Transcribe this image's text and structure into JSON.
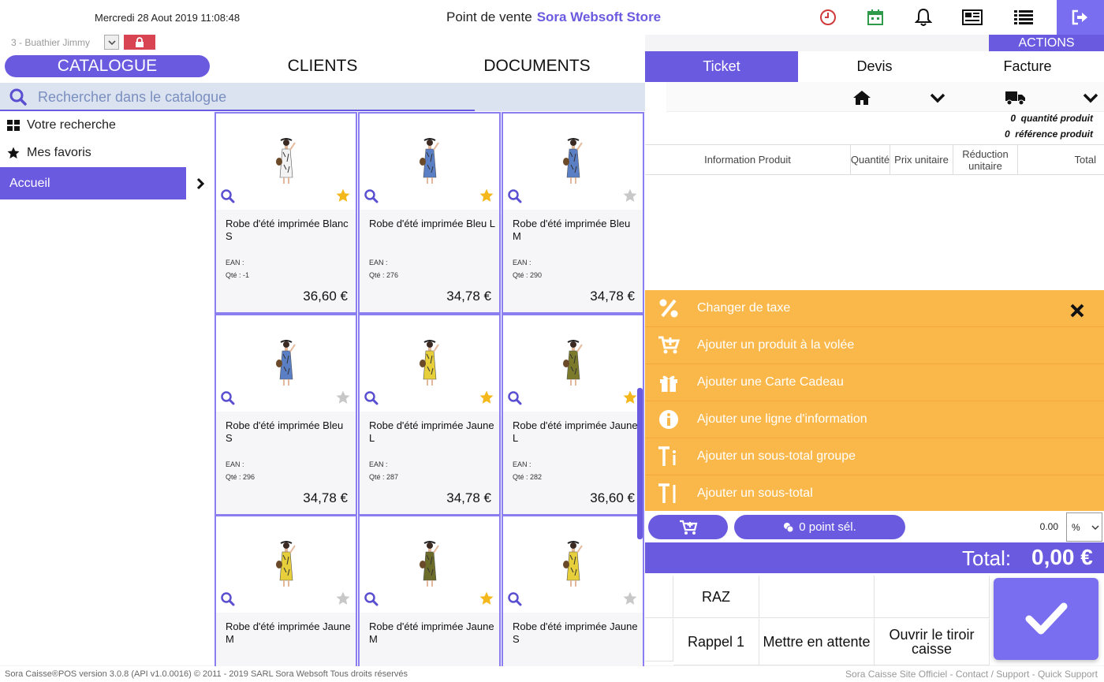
{
  "header": {
    "datetime": "Mercredi 28 Aout 2019 11:08:48",
    "title_prefix": "Point de vente",
    "store_name": "Sora Websoft Store",
    "user_name": "3 - Buathier Jimmy",
    "actions_label": "ACTIONS"
  },
  "tabs": {
    "catalogue": "CATALOGUE",
    "clients": "CLIENTS",
    "documents": "DOCUMENTS"
  },
  "search": {
    "placeholder": "Rechercher dans le catalogue"
  },
  "left_menu": {
    "search": "Votre recherche",
    "favorites": "Mes favoris",
    "home": "Accueil"
  },
  "products": [
    {
      "name": "Robe d'été imprimée Blanc S",
      "ean": "EAN :",
      "qte": "Qté : -1",
      "price": "36,60 €",
      "fav": true,
      "color": "#f3f3f3"
    },
    {
      "name": "Robe d'été imprimée Bleu L",
      "ean": "EAN :",
      "qte": "Qté : 276",
      "price": "34,78 €",
      "fav": true,
      "color": "#5b7fc4"
    },
    {
      "name": "Robe d'été imprimée Bleu M",
      "ean": "EAN :",
      "qte": "Qté : 290",
      "price": "34,78 €",
      "fav": false,
      "color": "#5b7fc4"
    },
    {
      "name": "Robe d'été imprimée Bleu S",
      "ean": "EAN :",
      "qte": "Qté : 296",
      "price": "34,78 €",
      "fav": false,
      "color": "#5b7fc4"
    },
    {
      "name": "Robe d'été imprimée Jaune L",
      "ean": "EAN :",
      "qte": "Qté : 287",
      "price": "34,78 €",
      "fav": true,
      "color": "#e6cf3a"
    },
    {
      "name": "Robe d'été imprimée Jaune L",
      "ean": "EAN :",
      "qte": "Qté : 282",
      "price": "36,60 €",
      "fav": true,
      "color": "#7a7a2a"
    },
    {
      "name": "Robe d'été imprimée Jaune M",
      "ean": "",
      "qte": "",
      "price": "",
      "fav": false,
      "color": "#e6cf3a"
    },
    {
      "name": "Robe d'été imprimée Jaune M",
      "ean": "",
      "qte": "",
      "price": "",
      "fav": true,
      "color": "#6b6b2a"
    },
    {
      "name": "Robe d'été imprimée Jaune S",
      "ean": "",
      "qte": "",
      "price": "",
      "fav": false,
      "color": "#e6cf3a"
    }
  ],
  "ticket": {
    "tabs": {
      "ticket": "Ticket",
      "devis": "Devis",
      "facture": "Facture"
    },
    "qty_count": "0",
    "qty_label": "quantité produit",
    "ref_count": "0",
    "ref_label": "référence produit",
    "columns": {
      "info": "Information Produit",
      "qty": "Quantité",
      "unit_price": "Prix unitaire",
      "discount": "Réduction unitaire",
      "total": "Total"
    }
  },
  "actions_menu": [
    {
      "label": "Changer de taxe",
      "icon": "percent-icon"
    },
    {
      "label": "Ajouter un produit à la volée",
      "icon": "cart-plus-icon"
    },
    {
      "label": "Ajouter une Carte Cadeau",
      "icon": "gift-icon"
    },
    {
      "label": "Ajouter une ligne d'information",
      "icon": "info-icon"
    },
    {
      "label": "Ajouter un sous-total groupe",
      "icon": "subtotal-group-icon"
    },
    {
      "label": "Ajouter un sous-total",
      "icon": "subtotal-icon"
    }
  ],
  "summary": {
    "points_label": "0 point sél.",
    "discount_value": "0.00",
    "discount_type": "%",
    "total_label": "Total:",
    "total_value": "0,00 €"
  },
  "keypad": {
    "raz": "RAZ",
    "recall": "Rappel 1",
    "hold": "Mettre en attente",
    "drawer": "Ouvrir le tiroir caisse"
  },
  "footer": {
    "copyright": "Sora Caisse®POS version 3.0.8 (API v1.0.0016) © 2011 - 2019 SARL Sora Websoft Tous droits réservés",
    "link_site": "Sora Caisse Site Officiel",
    "sep": " - ",
    "link_contact": "Contact / Support",
    "link_quick": "Quick Support"
  },
  "colors": {
    "accent": "#6a5ae0",
    "orange": "#fbb84a",
    "lock": "#d94452",
    "star_on": "#f5b81c",
    "star_off": "#c8c8c8"
  }
}
